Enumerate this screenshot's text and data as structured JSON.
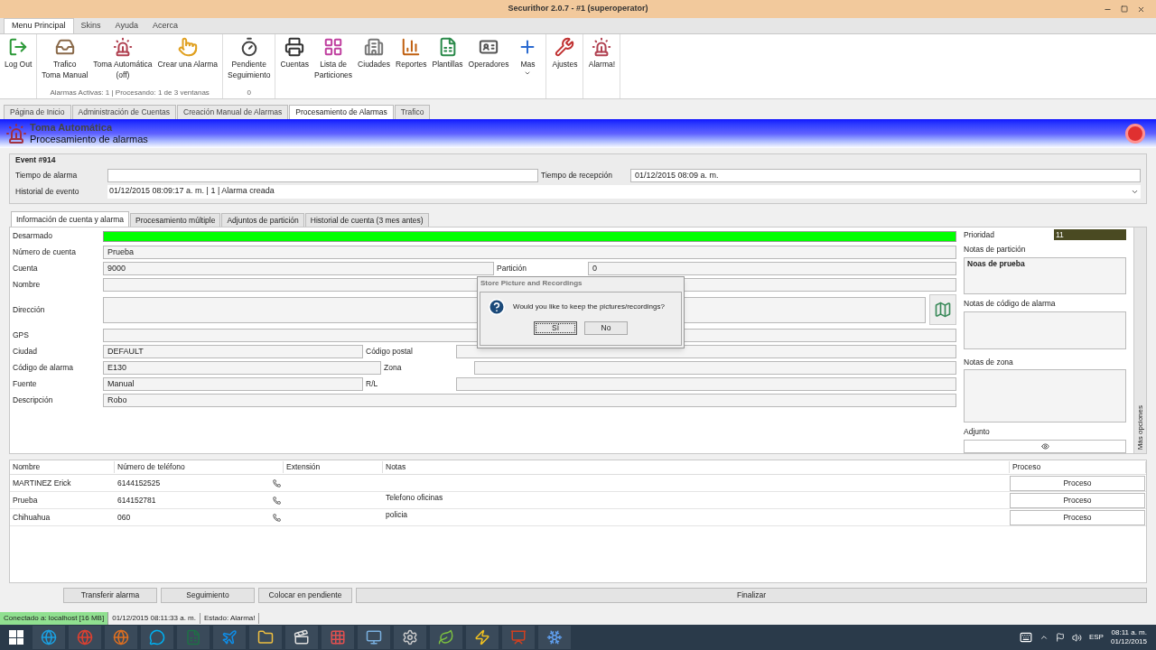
{
  "window": {
    "title": "Securithor 2.0.7  -  #1 (superoperator)"
  },
  "menu_tabs": [
    {
      "label": "Menu Principal",
      "selected": true
    },
    {
      "label": "Skins",
      "selected": false
    },
    {
      "label": "Ayuda",
      "selected": false
    },
    {
      "label": "Acerca",
      "selected": false
    }
  ],
  "ribbon": [
    {
      "items": [
        {
          "label": "Log Out"
        }
      ]
    },
    {
      "items": [
        {
          "label": "Trafico\nToma Manual"
        },
        {
          "label": "Toma Automática\n(off)"
        },
        {
          "label": "Crear una Alarma"
        }
      ],
      "footer": "Alarmas Activas: 1 | Procesando: 1 de 3 ventanas"
    },
    {
      "items": [
        {
          "label": "Pendiente\nSeguimiento"
        }
      ],
      "footer": "0"
    },
    {
      "items": [
        {
          "label": "Cuentas"
        },
        {
          "label": "Lista de\nParticiones"
        },
        {
          "label": "Ciudades"
        },
        {
          "label": "Reportes"
        },
        {
          "label": "Plantillas"
        },
        {
          "label": "Operadores"
        },
        {
          "label": "Mas",
          "dropdown": true
        }
      ]
    },
    {
      "items": [
        {
          "label": "Ajustes"
        }
      ]
    },
    {
      "items": [
        {
          "label": "Alarma!"
        }
      ]
    }
  ],
  "doc_tabs": [
    {
      "label": "Página de Inicio",
      "selected": false
    },
    {
      "label": "Administración de Cuentas",
      "selected": false
    },
    {
      "label": "Creación Manual de Alarmas",
      "selected": false
    },
    {
      "label": "Procesamiento de Alarmas",
      "selected": true
    },
    {
      "label": "Trafico",
      "selected": false
    }
  ],
  "header": {
    "mode": "Toma Automática",
    "title": "Procesamiento de alarmas"
  },
  "event": {
    "title": "Event #914",
    "alarm_time_label": "Tiempo de alarma",
    "reception_label": "Tiempo de recepción",
    "reception_value": "01/12/2015 08:09 a. m.",
    "history_label": "Historial de evento",
    "history_value": "01/12/2015 08:09:17 a. m. | 1 | Alarma creada"
  },
  "info_tabs": [
    {
      "label": "Información de cuenta y alarma",
      "selected": true
    },
    {
      "label": "Procesamiento múltiple",
      "selected": false
    },
    {
      "label": "Adjuntos de partición",
      "selected": false
    },
    {
      "label": "Historial de cuenta (3 mes antes)",
      "selected": false
    }
  ],
  "form": [
    {
      "kind": "status",
      "label": "Desarmado",
      "color": "#00ff00"
    },
    {
      "kind": "field",
      "label": "Número de cuenta",
      "value": "Prueba"
    },
    {
      "kind": "pair",
      "label": "Cuenta",
      "value": "9000",
      "label2": "Partición",
      "value2": "0"
    },
    {
      "kind": "field",
      "label": "Nombre"
    },
    {
      "kind": "address",
      "label": "Dirección"
    },
    {
      "kind": "field",
      "label": "GPS"
    },
    {
      "kind": "pair",
      "label": "Ciudad",
      "value": "DEFAULT",
      "label2": "Código postal"
    },
    {
      "kind": "pair",
      "label": "Código de alarma",
      "value": "E130",
      "label2": "Zona"
    },
    {
      "kind": "pair",
      "label": "Fuente",
      "value": "Manual",
      "label2": "R/L"
    },
    {
      "kind": "field",
      "label": "Descripción",
      "value": "Robo"
    }
  ],
  "side": {
    "priority_label": "Prioridad",
    "priority_value": "11",
    "partition_notes_label": "Notas de partición",
    "partition_notes": "Noas de prueba",
    "alarm_code_notes_label": "Notas de código de alarma",
    "zone_notes_label": "Notas de zona",
    "attachment_label": "Adjunto",
    "more_options": "Más opciones"
  },
  "dialog": {
    "title": "Store Picture and Recordings",
    "message": "Would you like to keep the pictures/recordings?",
    "buttons": [
      {
        "label": "Sí",
        "focused": true
      },
      {
        "label": "No",
        "focused": false
      }
    ]
  },
  "contacts": {
    "columns": [
      "Nombre",
      "Número de teléfono",
      "Extensión",
      "Notas",
      "Proceso"
    ],
    "rows": [
      {
        "name": "MARTINEZ Erick",
        "phone": "6144152525",
        "notes": "",
        "action": "Proceso"
      },
      {
        "name": "Prueba",
        "phone": "614152781",
        "notes": "Telefono oficinas",
        "action": "Proceso"
      },
      {
        "name": "Chihuahua",
        "phone": "060",
        "notes": "policia",
        "action": "Proceso"
      }
    ]
  },
  "actions": [
    "Transferir alarma",
    "Seguimiento",
    "Colocar en pendiente",
    "Finalizar"
  ],
  "status_bar": {
    "connection": "Conectado a: localhost [16 MB]",
    "time": "01/12/2015 08:11:33 a. m.",
    "state": "Estado: Alarma!"
  },
  "taskbar": {
    "language": "ESP",
    "time": "08:11 a. m.",
    "date": "01/12/2015"
  }
}
